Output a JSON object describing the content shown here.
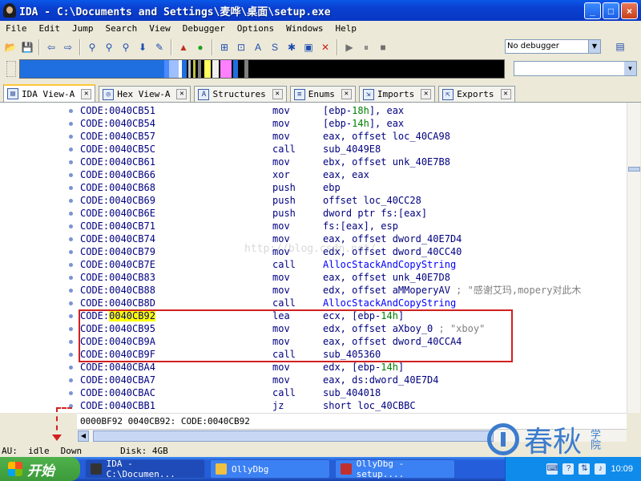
{
  "window": {
    "title": "IDA - C:\\Documents and Settings\\麦哗\\桌面\\setup.exe",
    "buttons": [
      "_",
      "□",
      "×"
    ]
  },
  "menu": [
    "File",
    "Edit",
    "Jump",
    "Search",
    "View",
    "Debugger",
    "Options",
    "Windows",
    "Help"
  ],
  "toolbar": {
    "debugger_select": "No debugger"
  },
  "tabs": [
    {
      "label": "IDA View-A",
      "icon": "ida-view-icon",
      "active": true
    },
    {
      "label": "Hex View-A",
      "icon": "hex-view-icon",
      "active": false
    },
    {
      "label": "Structures",
      "icon": "structures-icon",
      "active": false
    },
    {
      "label": "Enums",
      "icon": "enums-icon",
      "active": false
    },
    {
      "label": "Imports",
      "icon": "imports-icon",
      "active": false
    },
    {
      "label": "Exports",
      "icon": "exports-icon",
      "active": false
    }
  ],
  "disasm": [
    {
      "addr": "CODE:0040CB51",
      "mnem": "mov",
      "ops": "[ebp-18h], eax"
    },
    {
      "addr": "CODE:0040CB54",
      "mnem": "mov",
      "ops": "[ebp-14h], eax"
    },
    {
      "addr": "CODE:0040CB57",
      "mnem": "mov",
      "ops": "eax, offset loc_40CA98"
    },
    {
      "addr": "CODE:0040CB5C",
      "mnem": "call",
      "ops": "sub_4049E8"
    },
    {
      "addr": "CODE:0040CB61",
      "mnem": "mov",
      "ops": "ebx, offset unk_40E7B8"
    },
    {
      "addr": "CODE:0040CB66",
      "mnem": "xor",
      "ops": "eax, eax"
    },
    {
      "addr": "CODE:0040CB68",
      "mnem": "push",
      "ops": "ebp"
    },
    {
      "addr": "CODE:0040CB69",
      "mnem": "push",
      "ops": "offset loc_40CC28"
    },
    {
      "addr": "CODE:0040CB6E",
      "mnem": "push",
      "ops": "dword ptr fs:[eax]"
    },
    {
      "addr": "CODE:0040CB71",
      "mnem": "mov",
      "ops": "fs:[eax], esp"
    },
    {
      "addr": "CODE:0040CB74",
      "mnem": "mov",
      "ops": "eax, offset dword_40E7D4"
    },
    {
      "addr": "CODE:0040CB79",
      "mnem": "mov",
      "ops": "edx, offset dword_40CC40"
    },
    {
      "addr": "CODE:0040CB7E",
      "mnem": "call",
      "ops": "AllocStackAndCopyString"
    },
    {
      "addr": "CODE:0040CB83",
      "mnem": "mov",
      "ops": "eax, offset unk_40E7D8"
    },
    {
      "addr": "CODE:0040CB88",
      "mnem": "mov",
      "ops": "edx, offset aMMoperyAV",
      "comment": " ; \"感谢艾玛,mopery对此木"
    },
    {
      "addr": "CODE:0040CB8D",
      "mnem": "call",
      "ops": "AllocStackAndCopyString"
    },
    {
      "addr": "CODE:0040CB92",
      "mnem": "lea",
      "ops": "ecx, [ebp-14h]"
    },
    {
      "addr": "CODE:0040CB95",
      "mnem": "mov",
      "ops": "edx, offset aXboy_0",
      "comment": " ; \"xboy\""
    },
    {
      "addr": "CODE:0040CB9A",
      "mnem": "mov",
      "ops": "eax, offset dword_40CCA4"
    },
    {
      "addr": "CODE:0040CB9F",
      "mnem": "call",
      "ops": "sub_405360"
    },
    {
      "addr": "CODE:0040CBA4",
      "mnem": "mov",
      "ops": "edx, [ebp-14h]"
    },
    {
      "addr": "CODE:0040CBA7",
      "mnem": "mov",
      "ops": "eax, ds:dword_40E7D4"
    },
    {
      "addr": "CODE:0040CBAC",
      "mnem": "call",
      "ops": "sub_404018"
    },
    {
      "addr": "CODE:0040CBB1",
      "mnem": "jz",
      "ops": "short loc_40CBBC"
    }
  ],
  "watermark": "http://blog.csdn.net/",
  "address_status": "0000BF92 0040CB92: CODE:0040CB92",
  "status": {
    "au": "AU:",
    "au_state": "idle",
    "direction": "Down",
    "disk": "Disk: 4GB"
  },
  "logo": {
    "text": "春秋",
    "small": "学院"
  },
  "taskbar": {
    "start": "开始",
    "tasks": [
      {
        "label": "IDA - C:\\Documen...",
        "active": true
      },
      {
        "label": "OllyDbg",
        "active": false
      },
      {
        "label": "OllyDbg - setup....",
        "active": false
      }
    ],
    "clock": "10:09"
  },
  "colors": {
    "selection_box": "#d22020",
    "address": "#000080",
    "name_link": "#0000ff",
    "numeric": "#008000"
  }
}
